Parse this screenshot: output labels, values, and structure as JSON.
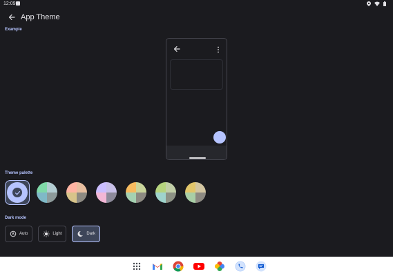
{
  "status_bar": {
    "time": "12:09",
    "icons": [
      "notification-icon",
      "location-icon",
      "wifi-icon",
      "battery-icon"
    ]
  },
  "app_bar": {
    "title": "App Theme",
    "back_icon": "back-arrow-icon"
  },
  "example": {
    "label": "Example",
    "preview_icons": [
      "back-arrow-icon",
      "more-vert-icon"
    ]
  },
  "palette": {
    "label": "Theme palette",
    "selected_index": 0,
    "swatches": [
      {
        "name": "blue",
        "colors": [
          "#b6c4ff",
          "#b6c4ff",
          "#b6c4ff",
          "#b6c4ff"
        ]
      },
      {
        "name": "green",
        "colors": [
          "#7fd9a8",
          "#b3cdd2",
          "#7fb9c7",
          "#8d9a9a"
        ]
      },
      {
        "name": "salmon",
        "colors": [
          "#ffb4a3",
          "#e8bfa0",
          "#d8c48a",
          "#8d8a82"
        ]
      },
      {
        "name": "lavender",
        "colors": [
          "#cbbeff",
          "#c8c0e8",
          "#f3b7d6",
          "#8d8a9a"
        ]
      },
      {
        "name": "orange",
        "colors": [
          "#f7bb5f",
          "#c9d59b",
          "#a5d1b1",
          "#8d8a82"
        ]
      },
      {
        "name": "lime",
        "colors": [
          "#b6d47e",
          "#c2cfa8",
          "#9fd4cc",
          "#8d9285"
        ]
      },
      {
        "name": "gold",
        "colors": [
          "#e2c66a",
          "#d3c6a1",
          "#a9cfa6",
          "#8d8a82"
        ]
      }
    ]
  },
  "dark_mode": {
    "label": "Dark mode",
    "options": [
      {
        "label": "Auto",
        "icon": "auto-brightness-icon",
        "selected": false
      },
      {
        "label": "Light",
        "icon": "sun-icon",
        "selected": false
      },
      {
        "label": "Dark",
        "icon": "moon-icon",
        "selected": true
      }
    ]
  },
  "taskbar": {
    "apps": [
      "app-drawer-icon",
      "gmail-icon",
      "chrome-icon",
      "youtube-icon",
      "photos-icon",
      "phone-icon",
      "messages-icon"
    ]
  },
  "colors": {
    "background": "#1b1b1f",
    "accent": "#b6c4ff",
    "selected_surface": "#3d4559"
  }
}
